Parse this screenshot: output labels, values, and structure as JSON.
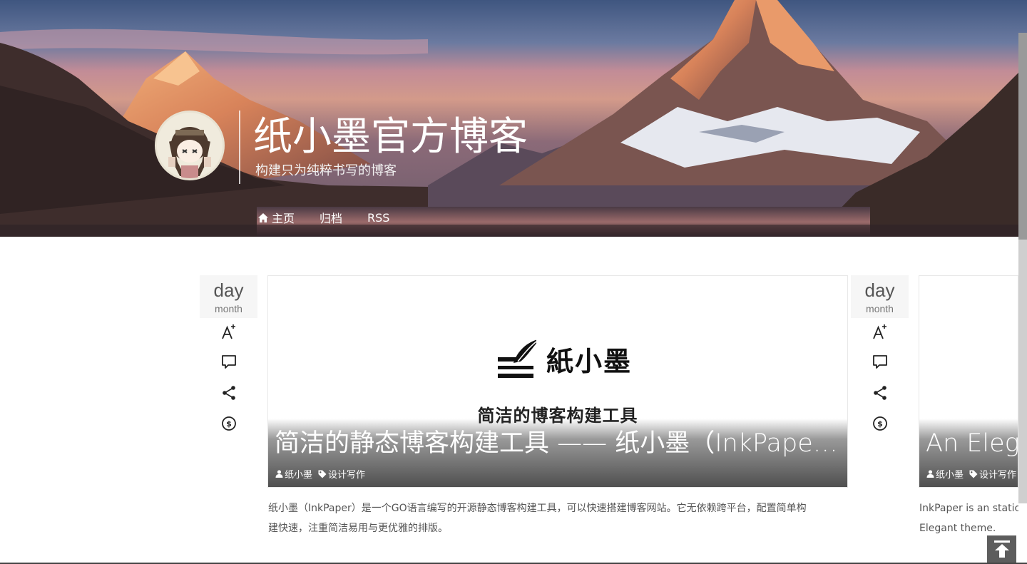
{
  "site": {
    "title": "纸小墨官方博客",
    "subtitle": "构建只为纯粹书写的博客"
  },
  "nav": {
    "items": [
      {
        "label": "主页",
        "icon": "home-icon"
      },
      {
        "label": "归档"
      },
      {
        "label": "RSS"
      }
    ]
  },
  "posts": [
    {
      "date_day": "day",
      "date_month": "month",
      "actions": [
        "font-size-icon",
        "comment-icon",
        "share-icon",
        "donate-icon"
      ],
      "cover": {
        "logo_text": "紙小墨",
        "tagline": "简洁的博客构建工具"
      },
      "title": "简洁的静态博客构建工具 —— 纸小墨（InkPaper）",
      "author": "纸小墨",
      "tag": "设计写作",
      "excerpt_line1": "纸小墨（InkPaper）是一个GO语言编写的开源静态博客构建工具，可以快速搭建博客网站。它无依赖跨平台，配置简单构",
      "excerpt_line2": "建快速，注重简洁易用与更优雅的排版。"
    },
    {
      "date_day": "day",
      "date_month": "month",
      "actions": [
        "font-size-icon",
        "comment-icon",
        "share-icon",
        "donate-icon"
      ],
      "title": "An Elegant",
      "author": "纸小墨",
      "tag": "设计写作",
      "excerpt_line1": "InkPaper is an static bl",
      "excerpt_line2": "Elegant theme."
    }
  ],
  "colors": {
    "header_text": "#ffffff",
    "card_overlay": "#3c3c3c",
    "excerpt_text": "#555555",
    "to_top_bg": "#5d5d5d"
  }
}
